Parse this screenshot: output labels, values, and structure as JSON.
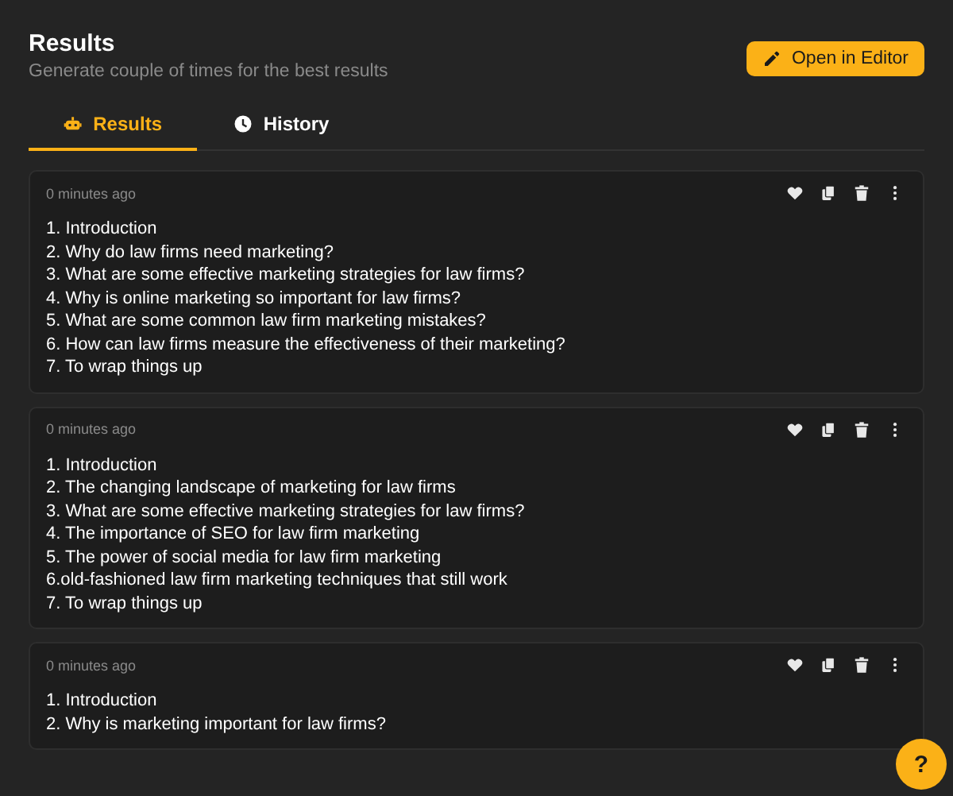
{
  "header": {
    "title": "Results",
    "subtitle": "Generate couple of times for the best results",
    "button": "Open in Editor"
  },
  "tabs": [
    {
      "label": "Results",
      "selected": true
    },
    {
      "label": "History",
      "selected": false
    }
  ],
  "results": [
    {
      "time": "0 minutes ago",
      "liked": false,
      "lines": [
        "1. Introduction",
        "2. Why do law firms need marketing?",
        "3. What are some effective marketing strategies for law firms?",
        "4. Why is online marketing so important for law firms?",
        "5. What are some common law firm marketing mistakes?",
        "6. How can law firms measure the effectiveness of their marketing?",
        "7. To wrap things up"
      ]
    },
    {
      "time": "0 minutes ago",
      "liked": false,
      "lines": [
        "1. Introduction",
        "2. The changing landscape of marketing for law firms",
        "3. What are some effective marketing strategies for law firms?",
        "4. The importance of SEO for law firm marketing",
        "5. The power of social media for law firm marketing",
        "6.old-fashioned law firm marketing techniques that still work",
        "7. To wrap things up"
      ]
    },
    {
      "time": "0 minutes ago",
      "liked": false,
      "lines": [
        "1. Introduction",
        "2. Why is marketing important for law firms?"
      ]
    }
  ],
  "help": "?"
}
